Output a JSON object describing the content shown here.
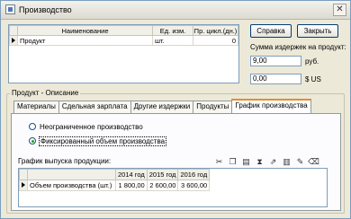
{
  "window": {
    "title": "Производство"
  },
  "products_table": {
    "headers": [
      "Наименование",
      "Ед. изм.",
      "Пр. цикл.(дн.)"
    ],
    "rows": [
      {
        "name": "Продукт",
        "unit": "шт.",
        "cycle": "0"
      }
    ]
  },
  "buttons": {
    "help": "Справка",
    "close": "Закрыть"
  },
  "costs": {
    "label": "Сумма издержек на продукт:",
    "rub_value": "9,00",
    "rub_unit": "руб.",
    "usd_value": "0,00",
    "usd_unit": "$ US"
  },
  "group": {
    "title": "Продукт - Описание"
  },
  "tabs": [
    "Материалы",
    "Сдельная зарплата",
    "Другие издержки",
    "Продукты",
    "График производства"
  ],
  "production": {
    "option_unlimited": "Неограниченное производство",
    "option_fixed": "Фиксированный объем производства",
    "selected": "fixed"
  },
  "schedule": {
    "label": "График выпуска продукции:",
    "years": [
      "2014 год",
      "2015 год",
      "2016 год"
    ],
    "row_label": "Объем производства (шт.)",
    "values": [
      "1 800,00",
      "2 600,00",
      "3 600,00"
    ]
  }
}
